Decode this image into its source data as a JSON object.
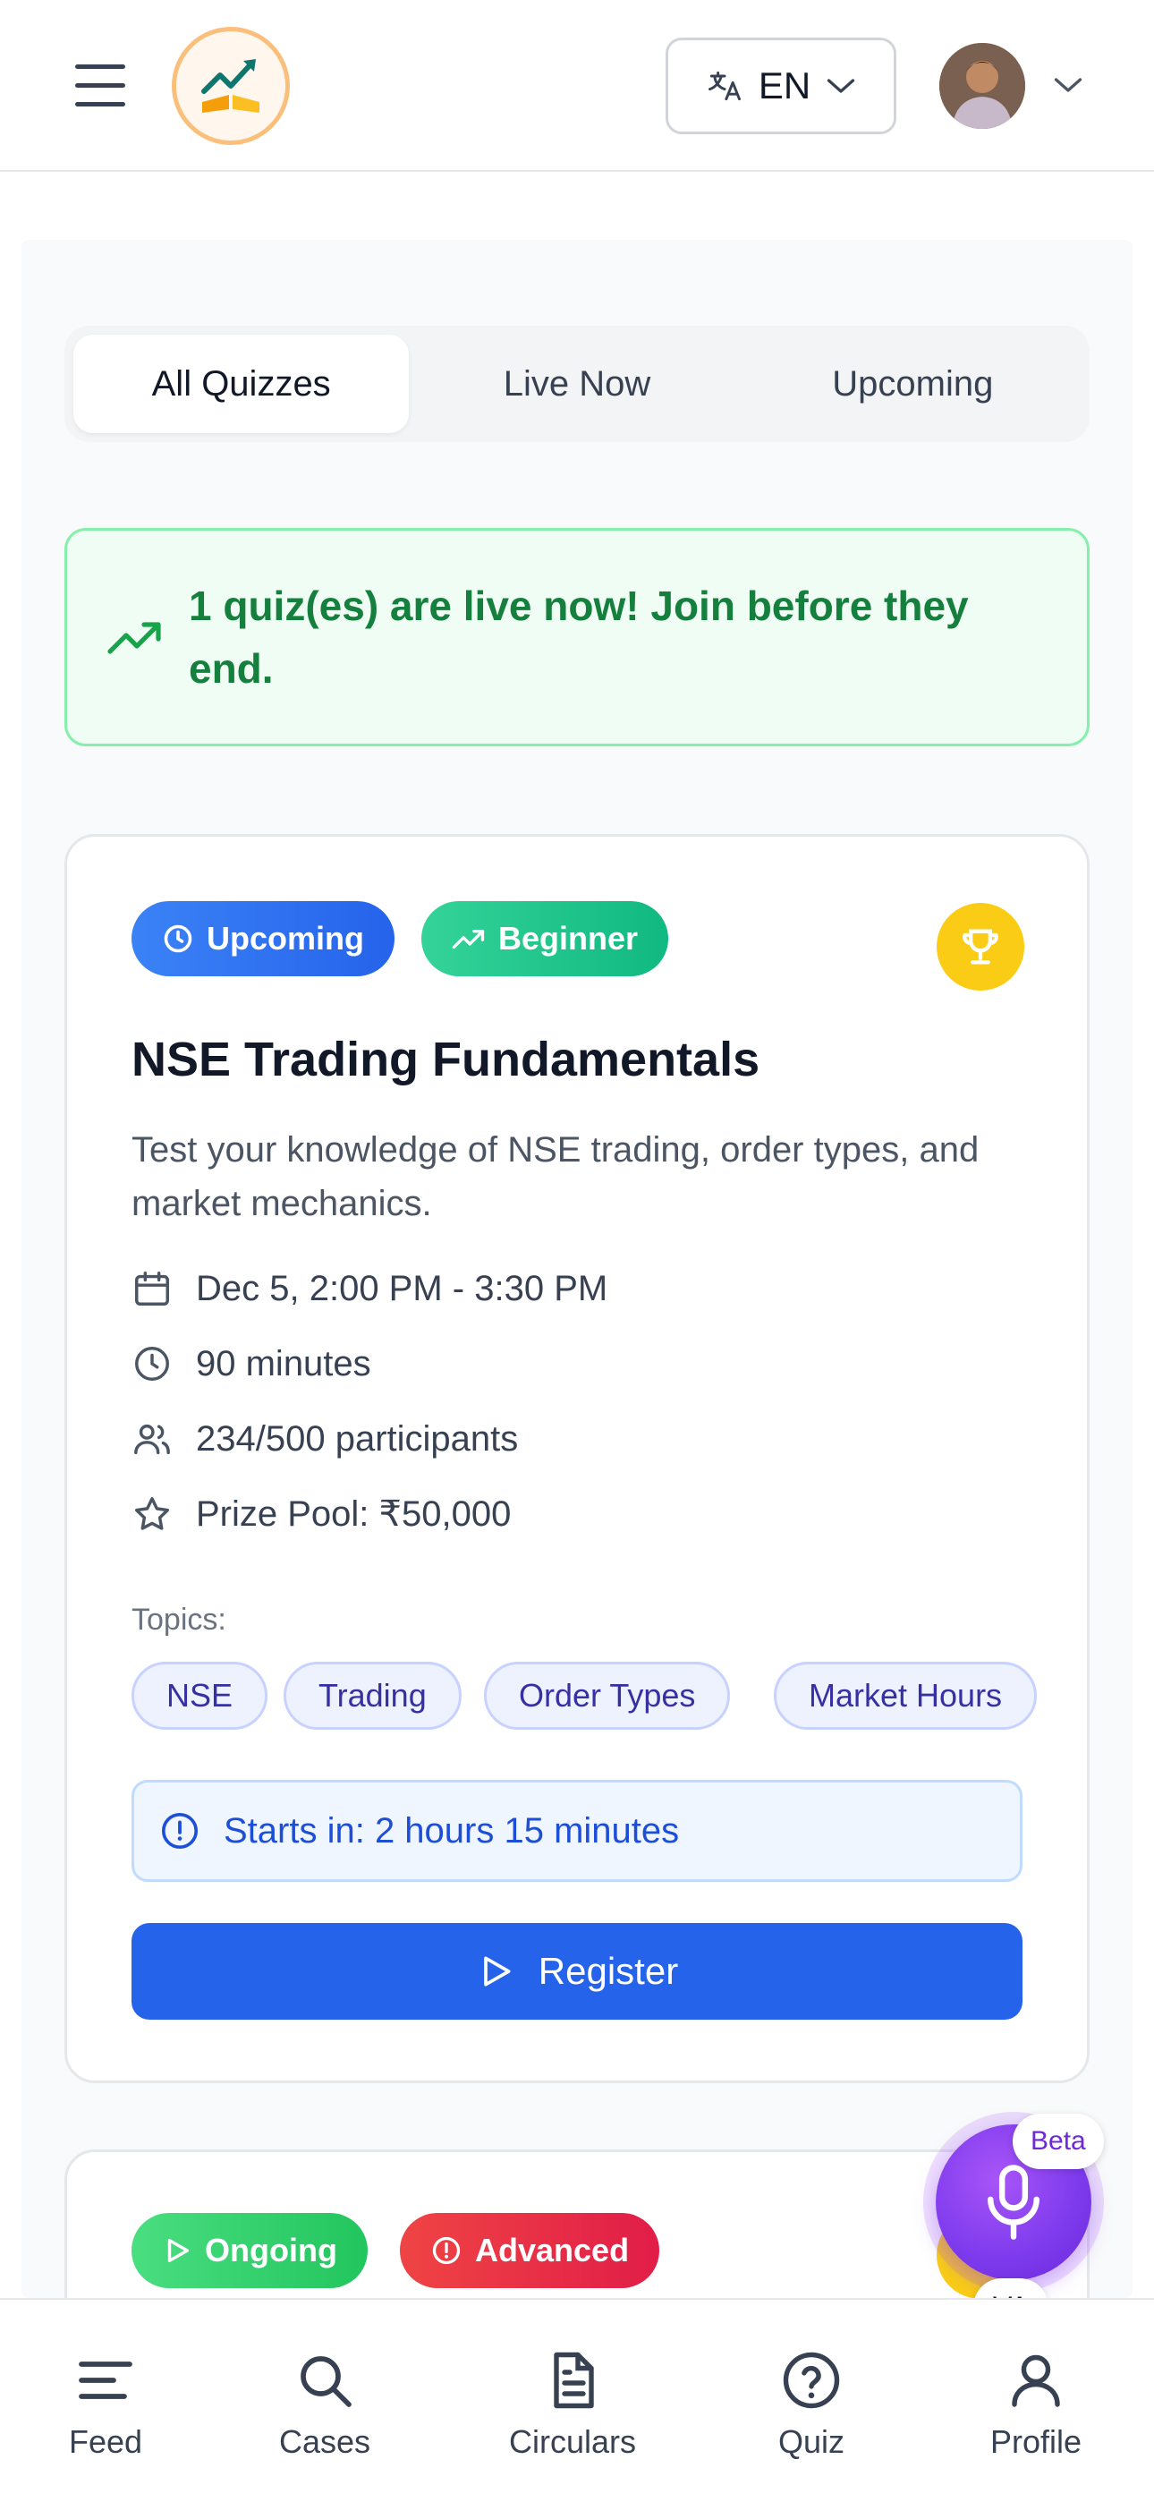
{
  "header": {
    "language": "EN",
    "icons": [
      "menu-icon",
      "app-logo",
      "translate-icon",
      "chevron-down-icon",
      "avatar"
    ]
  },
  "tabs": [
    {
      "label": "All Quizzes",
      "active": true
    },
    {
      "label": "Live Now",
      "active": false
    },
    {
      "label": "Upcoming",
      "active": false
    }
  ],
  "alert": {
    "text": "1 quiz(es) are live now! Join before they end.",
    "color": "#15803d"
  },
  "quiz_card": {
    "status_badge": "Upcoming",
    "level_badge": "Beginner",
    "title": "NSE Trading Fundamentals",
    "description": "Test your knowledge of NSE trading, order types, and market mechanics.",
    "schedule": "Dec 5, 2:00 PM - 3:30 PM",
    "duration": "90 minutes",
    "participants": "234/500 participants",
    "prize": "Prize Pool: ₹50,000",
    "topics_label": "Topics:",
    "topics": [
      "NSE",
      "Trading",
      "Order Types",
      "Market Hours"
    ],
    "countdown": "Starts in: 2 hours 15 minutes",
    "register_label": "Register"
  },
  "quiz_card_2": {
    "status_badge": "Ongoing",
    "level_badge": "Advanced"
  },
  "voice_assistant": {
    "beta": "Beta",
    "label": "VA"
  },
  "bottom_nav": [
    {
      "label": "Feed",
      "icon": "feed-icon"
    },
    {
      "label": "Cases",
      "icon": "search-icon"
    },
    {
      "label": "Circulars",
      "icon": "document-icon"
    },
    {
      "label": "Quiz",
      "icon": "help-circle-icon"
    },
    {
      "label": "Profile",
      "icon": "user-icon"
    }
  ],
  "colors": {
    "primary": "#2563eb",
    "success": "#22c55e",
    "danger": "#ef4444",
    "accent": "#7c3aed"
  }
}
